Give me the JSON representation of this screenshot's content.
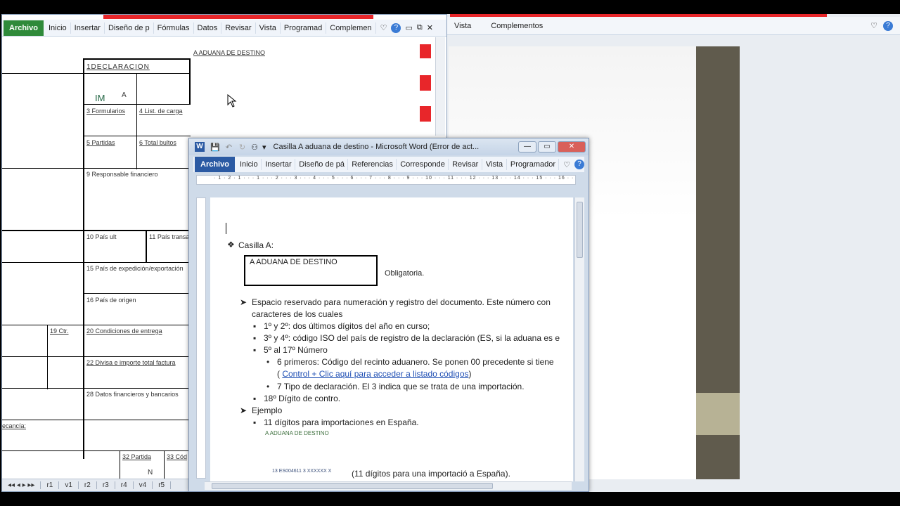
{
  "excel": {
    "ribbon": {
      "archivo": "Archivo",
      "tabs": [
        "Inicio",
        "Insertar",
        "Diseño de p",
        "Fórmulas",
        "Datos",
        "Revisar",
        "Vista",
        "Programad",
        "Complemen"
      ]
    },
    "cells": {
      "a_aduana": "A ADUANA DE DESTINO",
      "declaracion": "1DECLARACIÓN",
      "im": "IM",
      "a": "A",
      "formularios": "3 Formularios",
      "list_carga": "4 List. de carga",
      "partidas": "5 Partidas",
      "total_bultos": "6 Total bultos",
      "responsable": "9 Responsable financiero",
      "pais_ult": "10 País ult",
      "pais_trans": "11 País transa",
      "pais_exp": "15 País de expedición/exportación",
      "pais_origen": "16 País de origen",
      "ctr": "19 Ctr.",
      "condiciones": "20 Condiciones de entrega",
      "divisa": "22 Divisa e importe total factura",
      "datos_fin": "28 Datos financieros y bancarios",
      "ecancia": "ecancía:",
      "partida32": "32 Partida",
      "cod33": "33 Cód",
      "n": "N"
    },
    "sheet_tabs": [
      "r1",
      "v1",
      "r2",
      "r3",
      "r4",
      "v4",
      "r5"
    ]
  },
  "background_window": {
    "tabs": [
      "Vista",
      "Complementos"
    ]
  },
  "word": {
    "title": "Casilla A aduana de destino - Microsoft Word (Error de act...",
    "ribbon": {
      "archivo": "Archivo",
      "tabs": [
        "Inicio",
        "Insertar",
        "Diseño de pá",
        "Referencias",
        "Corresponde",
        "Revisar",
        "Vista",
        "Programador"
      ]
    },
    "ruler": "· 1 · 2 · 1 · · · 1 · · · 2 · · · 3 · · · 4 · · · 5 · · · 6 · · · 7 · · · 8 · · · 9 · · · 10 · · · 11 · · · 12 · · · 13 · · · 14 · · · 15 · · · 16 · · · 17",
    "doc": {
      "casilla": "Casilla A:",
      "box_text": "A  ADUANA DE DESTINO",
      "obligatoria": "Obligatoria.",
      "espacio": "Espacio reservado para numeración y registro del documento. Este número con",
      "caracteres": "caracteres de los cuales",
      "b1": "1º y 2º: dos últimos dígitos del año en curso;",
      "b2": "3º y 4º: código ISO del país de registro de la declaración (ES, si la aduana es e",
      "b3": "5º al 17º Número",
      "c1": "6 primeros: Código del recinto aduanero. Se ponen 00  precedente si tiene",
      "c1_paren_open": "( ",
      "c1_link": "Control + Clic aquí para acceder a  listado códigos",
      "c1_paren_close": ")",
      "c2": "7 Tipo de declaración.  El 3 indica  que se trata de una importación.",
      "b4": "18º Dígito de contro.",
      "ejemplo": "Ejemplo",
      "e1": "11 dígitos para importaciones en España.",
      "small_label": "A ADUANA DE DESTINO",
      "small_code": "13 ES004611 3 XXXXXX X",
      "last_line": "(11 dígitos para una importació a España)."
    }
  }
}
